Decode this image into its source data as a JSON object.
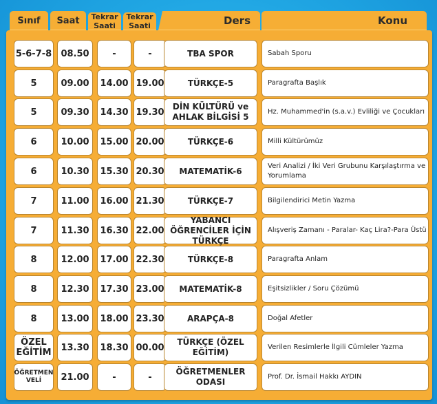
{
  "headers": {
    "sinif": "Sınıf",
    "saat": "Saat",
    "tekrar1": "Tekrar Saati",
    "tekrar2": "Tekrar Saati",
    "ders": "Ders",
    "konu": "Konu"
  },
  "rows": [
    {
      "sinif": "5-6-7-8",
      "saat": "08.50",
      "tekrar1": "-",
      "tekrar2": "-",
      "ders": "TBA SPOR",
      "konu": "Sabah Sporu"
    },
    {
      "sinif": "5",
      "saat": "09.00",
      "tekrar1": "14.00",
      "tekrar2": "19.00",
      "ders": "TÜRKÇE-5",
      "konu": "Paragrafta Başlık"
    },
    {
      "sinif": "5",
      "saat": "09.30",
      "tekrar1": "14.30",
      "tekrar2": "19.30",
      "ders": "DİN KÜLTÜRÜ ve AHLAK BİLGİSİ 5",
      "konu": "Hz. Muhammed'in (s.a.v.) Evliliği ve Çocukları"
    },
    {
      "sinif": "6",
      "saat": "10.00",
      "tekrar1": "15.00",
      "tekrar2": "20.00",
      "ders": "TÜRKÇE-6",
      "konu": "Milli Kültürümüz"
    },
    {
      "sinif": "6",
      "saat": "10.30",
      "tekrar1": "15.30",
      "tekrar2": "20.30",
      "ders": "MATEMATİK-6",
      "konu": "Veri Analizi / İki Veri Grubunu Karşılaştırma ve Yorumlama"
    },
    {
      "sinif": "7",
      "saat": "11.00",
      "tekrar1": "16.00",
      "tekrar2": "21.30",
      "ders": "TÜRKÇE-7",
      "konu": "Bilgilendirici Metin Yazma"
    },
    {
      "sinif": "7",
      "saat": "11.30",
      "tekrar1": "16.30",
      "tekrar2": "22.00",
      "ders": "YABANCI ÖĞRENCİLER İÇİN TÜRKÇE",
      "konu": "Alışveriş Zamanı - Paralar- Kaç Lira?-Para Üstü"
    },
    {
      "sinif": "8",
      "saat": "12.00",
      "tekrar1": "17.00",
      "tekrar2": "22.30",
      "ders": "TÜRKÇE-8",
      "konu": "Paragrafta Anlam"
    },
    {
      "sinif": "8",
      "saat": "12.30",
      "tekrar1": "17.30",
      "tekrar2": "23.00",
      "ders": "MATEMATİK-8",
      "konu": "Eşitsizlikler / Soru Çözümü"
    },
    {
      "sinif": "8",
      "saat": "13.00",
      "tekrar1": "18.00",
      "tekrar2": "23.30",
      "ders": "ARAPÇA-8",
      "konu": "Doğal Afetler"
    },
    {
      "sinif": "ÖZEL EĞİTİM",
      "saat": "13.30",
      "tekrar1": "18.30",
      "tekrar2": "00.00",
      "ders": "TÜRKÇE (ÖZEL EĞİTİM)",
      "konu": "Verilen Resimlerle İlgili Cümleler Yazma"
    },
    {
      "sinif": "ÖĞRETMEN VELİ",
      "saat": "21.00",
      "tekrar1": "-",
      "tekrar2": "-",
      "ders": "ÖĞRETMENLER ODASI",
      "konu": "Prof. Dr. İsmail Hakkı AYDIN"
    }
  ]
}
